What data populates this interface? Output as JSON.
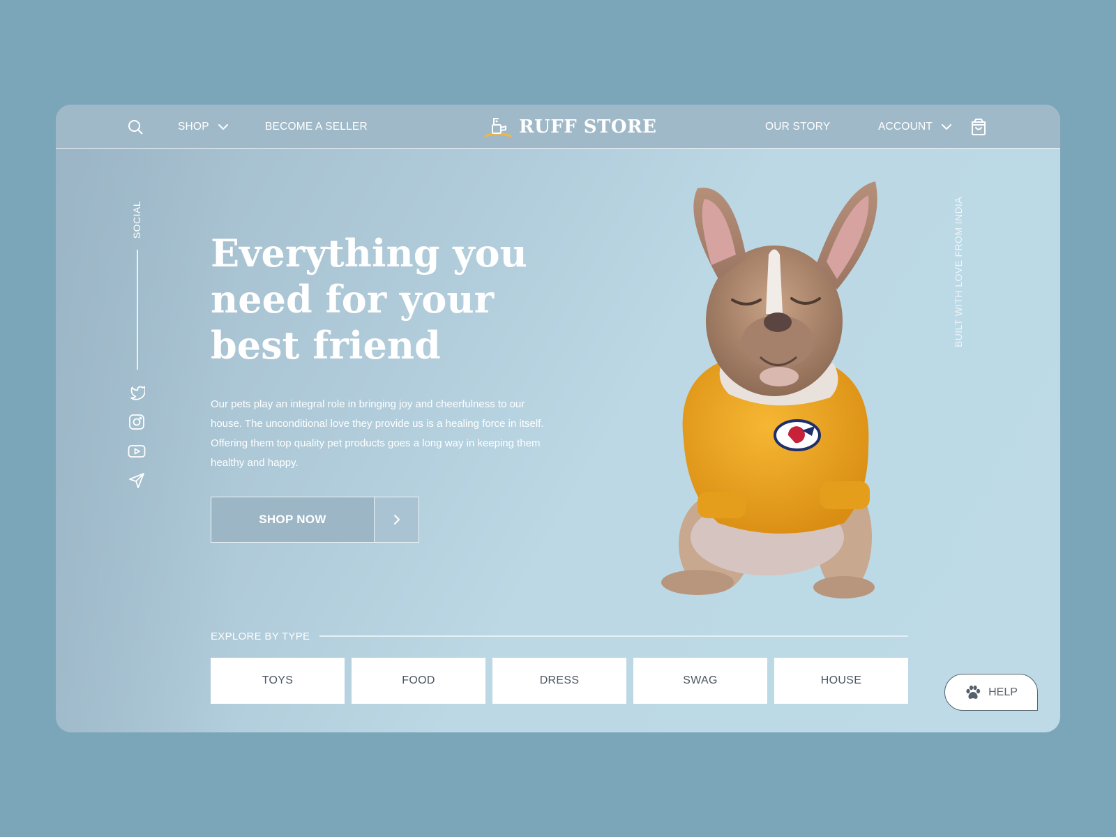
{
  "nav": {
    "shop_label": "SHOP",
    "seller_label": "BECOME A SELLER",
    "brand_name": "RUFF STORE",
    "story_label": "OUR STORY",
    "account_label": "ACCOUNT"
  },
  "social": {
    "label": "SOCIAL",
    "icons": [
      "twitter-icon",
      "instagram-icon",
      "youtube-icon",
      "send-icon"
    ]
  },
  "side_note": "BUILT WITH LOVE FROM INDIA",
  "hero": {
    "title": "Everything you\nneed for your\nbest friend",
    "description": "Our pets play an integral role in bringing joy and cheerfulness to our house. The unconditional love they provide us is a healing force in itself. Offering them top quality pet products goes a long way in keeping them healthy and happy.",
    "cta_label": "SHOP NOW"
  },
  "explore": {
    "label": "EXPLORE BY TYPE",
    "types": [
      "TOYS",
      "FOOD",
      "DRESS",
      "SWAG",
      "HOUSE"
    ]
  },
  "help": {
    "label": "HELP"
  },
  "colors": {
    "page_bg": "#7ba6b9",
    "nav_bg": "#a0b9c8",
    "hero_bg": "#bcd8e5",
    "sweater": "#f2a923",
    "logo_accent": "#f4b63c"
  }
}
